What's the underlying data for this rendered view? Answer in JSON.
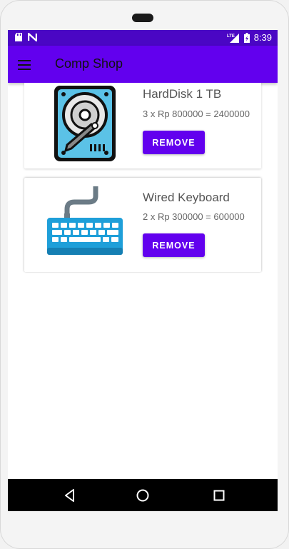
{
  "status_bar": {
    "time": "8:39",
    "icons": [
      "sd-card-icon",
      "notification-n-icon",
      "lte-signal-icon",
      "battery-icon"
    ],
    "network_label": "LTE"
  },
  "app_bar": {
    "title": "Comp Shop",
    "menu_icon": "hamburger-menu-icon",
    "color": "#6200ee"
  },
  "cart": {
    "items": [
      {
        "name": "HardDisk 1 TB",
        "detail": "3 x Rp 800000 = 2400000",
        "image_icon": "harddisk-icon",
        "remove_label": "REMOVE"
      },
      {
        "name": "Wired Keyboard",
        "detail": "2 x Rp 300000 = 600000",
        "image_icon": "keyboard-icon",
        "remove_label": "REMOVE"
      }
    ]
  },
  "nav_bar": {
    "buttons": [
      "back-icon",
      "home-icon",
      "recent-apps-icon"
    ]
  },
  "colors": {
    "accent": "#6200ee",
    "status_bar": "#4a06c4",
    "nav_bar": "#000000"
  }
}
